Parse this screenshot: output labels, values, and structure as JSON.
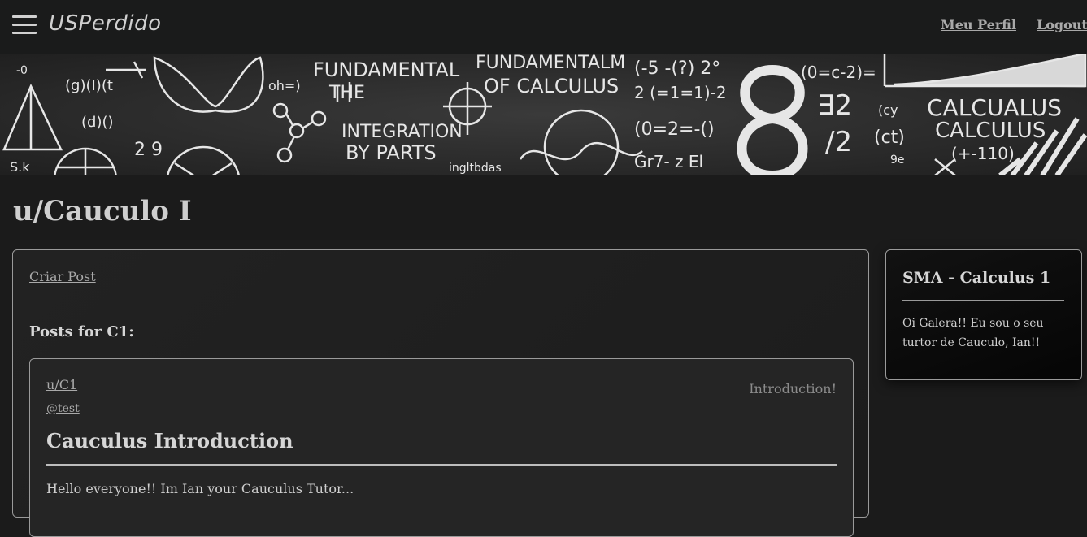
{
  "header": {
    "brand": "USPerdido",
    "profile_link": "Meu Perfil",
    "logout_link": "Logout"
  },
  "banner": {
    "words": [
      "FUNDAMENTAL",
      "THE",
      "FUNDAMENTALM",
      "OF CALCULUS",
      "INTEGRATION",
      "BY PARTS",
      "CALCUALUS",
      "CALCULUS"
    ]
  },
  "page": {
    "title": "u/Cauculo I"
  },
  "main": {
    "create_post": "Criar Post",
    "posts_heading": "Posts for C1:",
    "posts": [
      {
        "subforum": "u/C1",
        "author": "@test",
        "tag": "Introduction!",
        "title": "Cauculus Introduction",
        "body": "Hello everyone!! Im Ian your Cauculus Tutor..."
      }
    ]
  },
  "sidebar": {
    "title": "SMA - Calculus 1",
    "description": "Oi Galera!! Eu sou o seu turtor de Cauculo, Ian!!"
  }
}
